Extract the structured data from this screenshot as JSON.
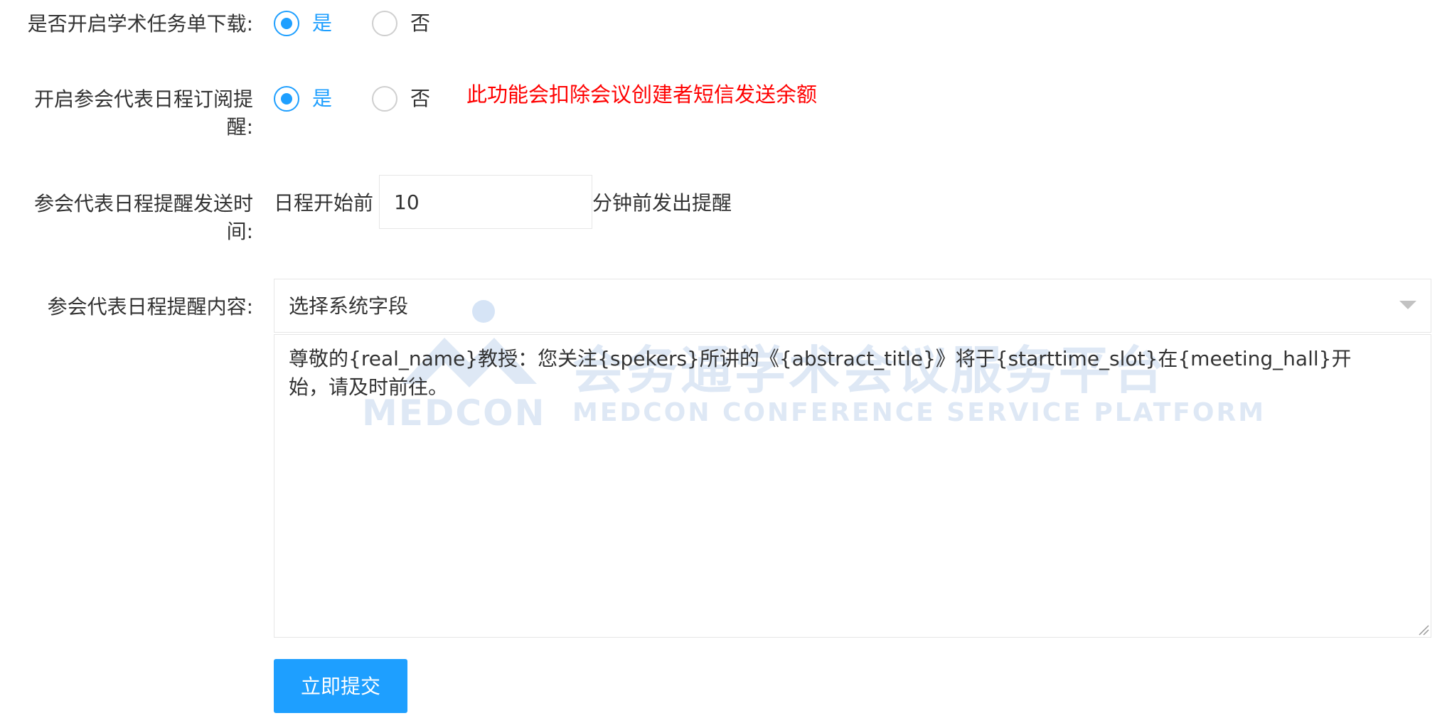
{
  "form": {
    "academic_download": {
      "label": "是否开启学术任务单下载:",
      "options": [
        "是",
        "否"
      ],
      "selected": "是"
    },
    "schedule_subscribe": {
      "label_line1": "开启参会代表日程订阅提",
      "label_line2": "醒:",
      "options": [
        "是",
        "否"
      ],
      "selected": "是",
      "warning": "此功能会扣除会议创建者短信发送余额"
    },
    "remind_time": {
      "label_line1": "参会代表日程提醒发送时",
      "label_line2": "间:",
      "prefix": "日程开始前",
      "value": "10",
      "suffix": "分钟前发出提醒"
    },
    "remind_content": {
      "label": "参会代表日程提醒内容:",
      "select_placeholder": "选择系统字段",
      "text": "尊敬的{real_name}教授：您关注{spekers}所讲的《{abstract_title}》将于{starttime_slot}在{meeting_hall}开始，请及时前往。"
    },
    "submit_label": "立即提交"
  },
  "watermark": {
    "cn": "会务通学术会议服务平台",
    "logo": "MEDCON",
    "en": "MEDCON CONFERENCE SERVICE PLATFORM"
  },
  "colors": {
    "accent": "#1E9FFF",
    "warning": "#ff0000",
    "watermark": "#dbe6f4"
  }
}
